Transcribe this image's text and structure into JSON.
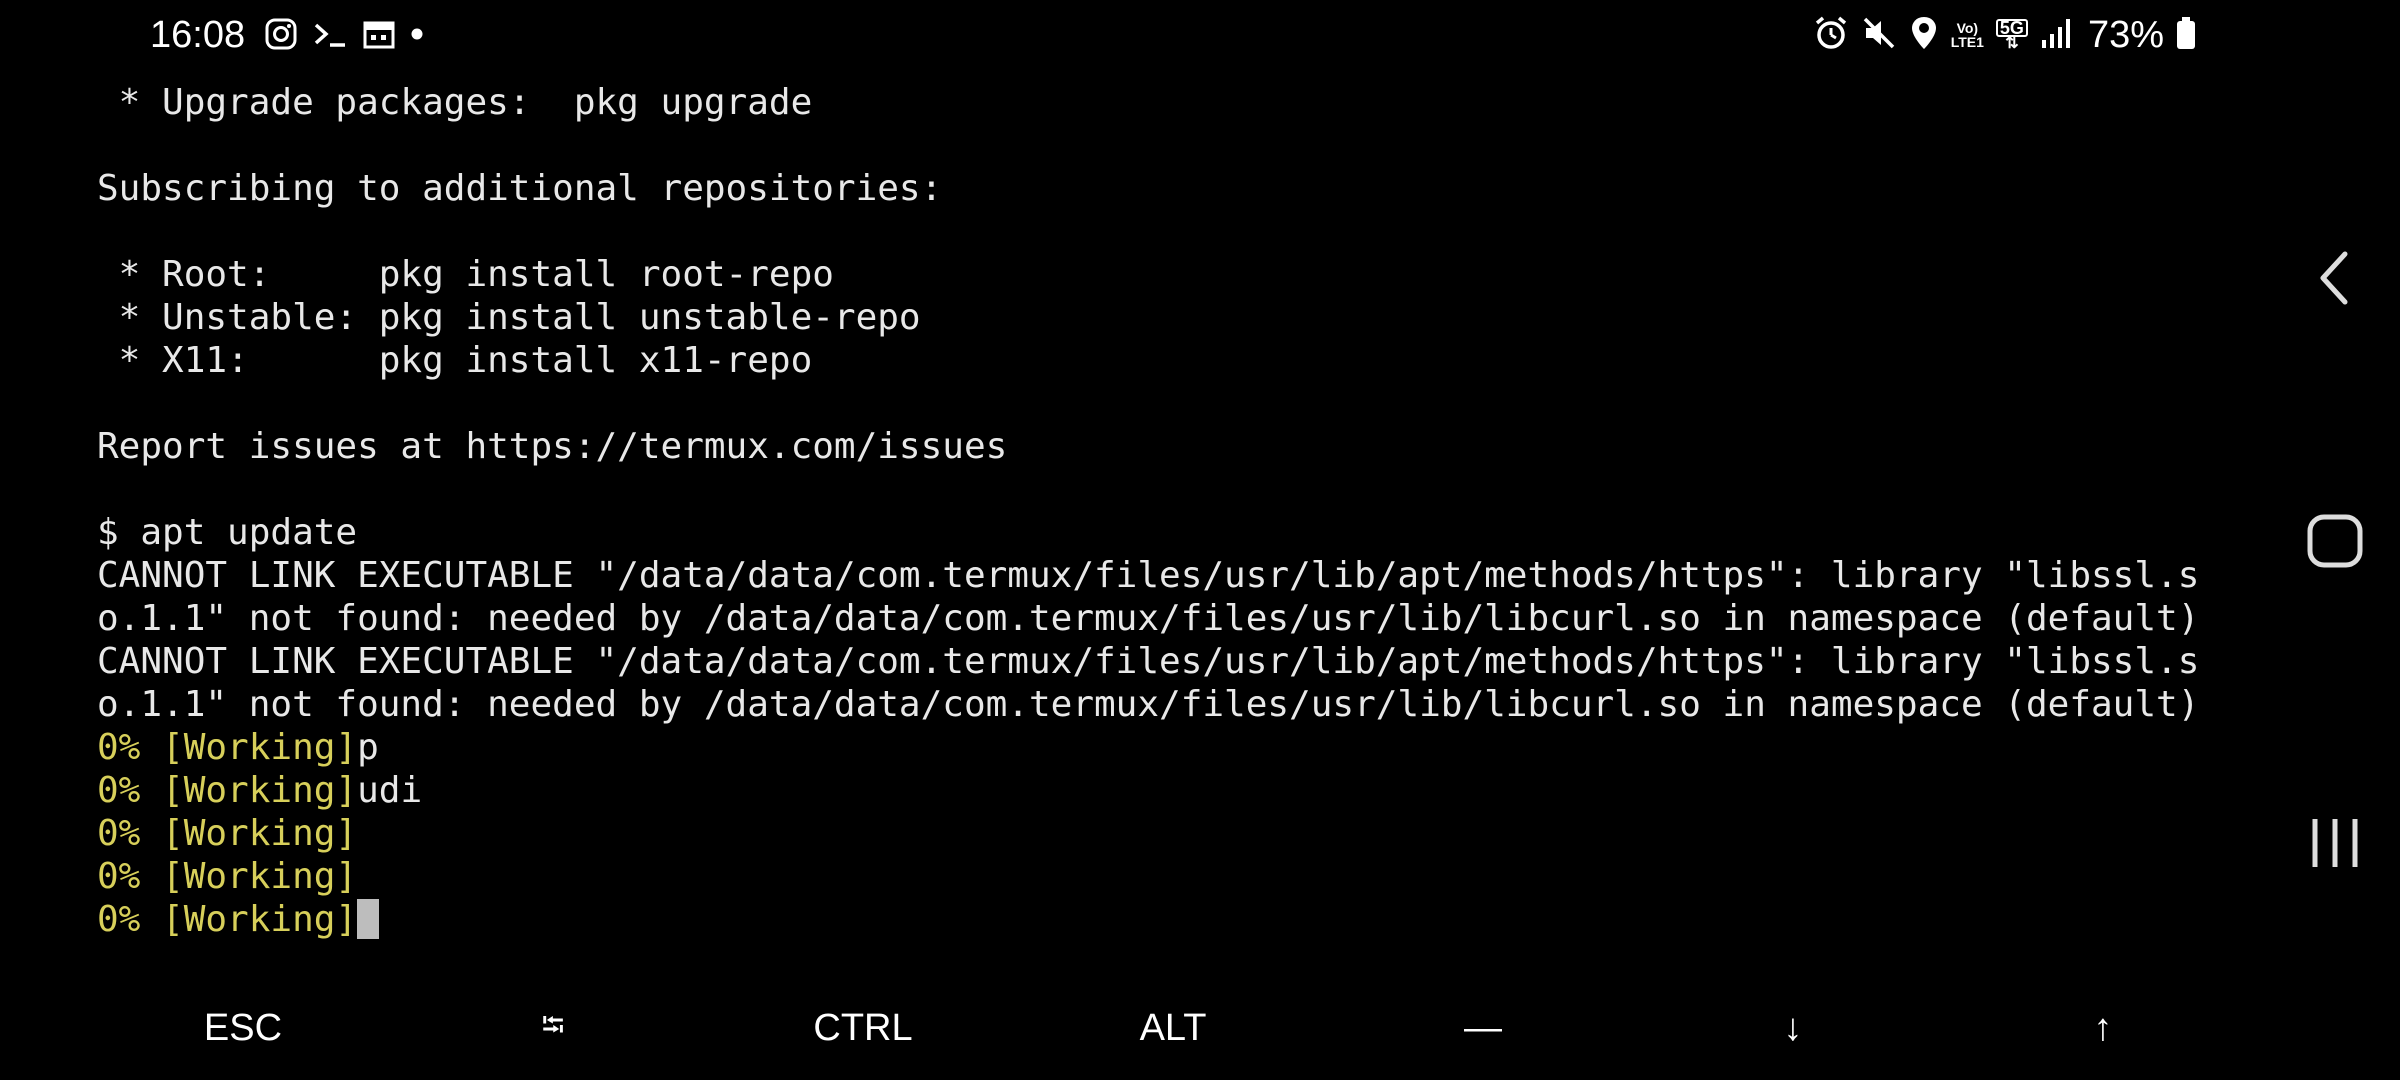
{
  "status_bar": {
    "time": "16:08",
    "battery_percent": "73%",
    "network_badge_top": "Vo)",
    "network_badge_bottom": "LTE1",
    "network_type": "5G",
    "left_icons": [
      "instagram-icon",
      "terminal-icon",
      "calendar-icon",
      "dot-icon"
    ],
    "right_icons": [
      "alarm-icon",
      "mute-icon",
      "location-icon",
      "volte-icon",
      "5g-icon",
      "signal-icon",
      "battery-icon"
    ]
  },
  "terminal": {
    "lines": [
      {
        "text": " * Upgrade packages:  pkg upgrade",
        "tail": "",
        "color": "default"
      },
      {
        "text": "",
        "tail": "",
        "color": "default"
      },
      {
        "text": "Subscribing to additional repositories:",
        "tail": "",
        "color": "default"
      },
      {
        "text": "",
        "tail": "",
        "color": "default"
      },
      {
        "text": " * Root:     pkg install root-repo",
        "tail": "",
        "color": "default"
      },
      {
        "text": " * Unstable: pkg install unstable-repo",
        "tail": "",
        "color": "default"
      },
      {
        "text": " * X11:      pkg install x11-repo",
        "tail": "",
        "color": "default"
      },
      {
        "text": "",
        "tail": "",
        "color": "default"
      },
      {
        "text": "Report issues at https://termux.com/issues",
        "tail": "",
        "color": "default"
      },
      {
        "text": "",
        "tail": "",
        "color": "default"
      },
      {
        "text": "$ apt update",
        "tail": "",
        "color": "default"
      },
      {
        "text": "CANNOT LINK EXECUTABLE \"/data/data/com.termux/files/usr/lib/apt/methods/https\": library \"libssl.s",
        "tail": "",
        "color": "default"
      },
      {
        "text": "o.1.1\" not found: needed by /data/data/com.termux/files/usr/lib/libcurl.so in namespace (default)",
        "tail": "",
        "color": "default"
      },
      {
        "text": "CANNOT LINK EXECUTABLE \"/data/data/com.termux/files/usr/lib/apt/methods/https\": library \"libssl.s",
        "tail": "",
        "color": "default"
      },
      {
        "text": "o.1.1\" not found: needed by /data/data/com.termux/files/usr/lib/libcurl.so in namespace (default)",
        "tail": "",
        "color": "default"
      },
      {
        "text": "0% [Working]",
        "tail": "p",
        "color": "yellow"
      },
      {
        "text": "0% [Working]",
        "tail": "udi",
        "color": "yellow"
      },
      {
        "text": "0% [Working]",
        "tail": "",
        "color": "yellow"
      },
      {
        "text": "0% [Working]",
        "tail": "",
        "color": "yellow"
      },
      {
        "text": "0% [Working]",
        "tail": "",
        "color": "yellow",
        "cursor": true
      }
    ]
  },
  "extra_keys": {
    "esc": "ESC",
    "tab": "⭾",
    "ctrl": "CTRL",
    "alt": "ALT",
    "dash": "—",
    "down": "↓",
    "up": "↑"
  },
  "nav": {
    "icons": [
      "back-icon",
      "home-icon",
      "recents-icon"
    ]
  },
  "colors": {
    "background": "#000000",
    "text": "#e8e8e8",
    "working_yellow": "#d7cf5a",
    "cursor": "#bdbdbd"
  }
}
